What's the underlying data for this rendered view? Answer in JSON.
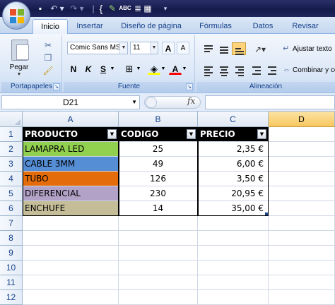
{
  "quick_access": {
    "undo_label": "↶ ▾",
    "redo_label": "↷ ▾",
    "brace": "{",
    "abc_label": "ABC",
    "more": "▾"
  },
  "tabs": [
    "Inicio",
    "Insertar",
    "Diseño de página",
    "Fórmulas",
    "Datos",
    "Revisar"
  ],
  "ribbon": {
    "groups": [
      "Portapapeles",
      "Fuente",
      "Alineación"
    ],
    "paste_label": "Pegar",
    "font_name": "Comic Sans MS",
    "font_size": "11",
    "bold": "N",
    "italic": "K",
    "underline": "S",
    "font_color_glyph": "A",
    "grow_font": "A",
    "shrink_font": "A",
    "wrap_text": "Ajustar texto",
    "merge_cells": "Combinar y centrar"
  },
  "formula_bar": {
    "name_box": "D21",
    "fx": "fx",
    "formula": ""
  },
  "sheet": {
    "columns": [
      "A",
      "B",
      "C",
      "D"
    ],
    "selected_column": "D",
    "rows": [
      "1",
      "2",
      "3",
      "4",
      "5",
      "6",
      "7",
      "8",
      "9",
      "10",
      "11",
      "12"
    ],
    "table_headers": [
      "PRODUCTO",
      "CODIGO",
      "PRECIO"
    ],
    "table_rows": [
      {
        "producto": "LAMAPRA LED",
        "codigo": "25",
        "precio": "2,35 €",
        "color": "#92d050"
      },
      {
        "producto": "CABLE 3MM",
        "codigo": "49",
        "precio": "6,00 €",
        "color": "#558ed5"
      },
      {
        "producto": "TUBO",
        "codigo": "126",
        "precio": "3,50 €",
        "color": "#e46c0a"
      },
      {
        "producto": "DIFERENCIAL",
        "codigo": "230",
        "precio": "20,95 €",
        "color": "#b3a2c7"
      },
      {
        "producto": "ENCHUFE",
        "codigo": "14",
        "precio": "35,00 €",
        "color": "#c4bd97"
      }
    ]
  },
  "colors": {
    "title_bar": "#1b2156",
    "ribbon": "#dbe7f7",
    "selected_header": "#f8c860",
    "table_header": "#000000"
  }
}
